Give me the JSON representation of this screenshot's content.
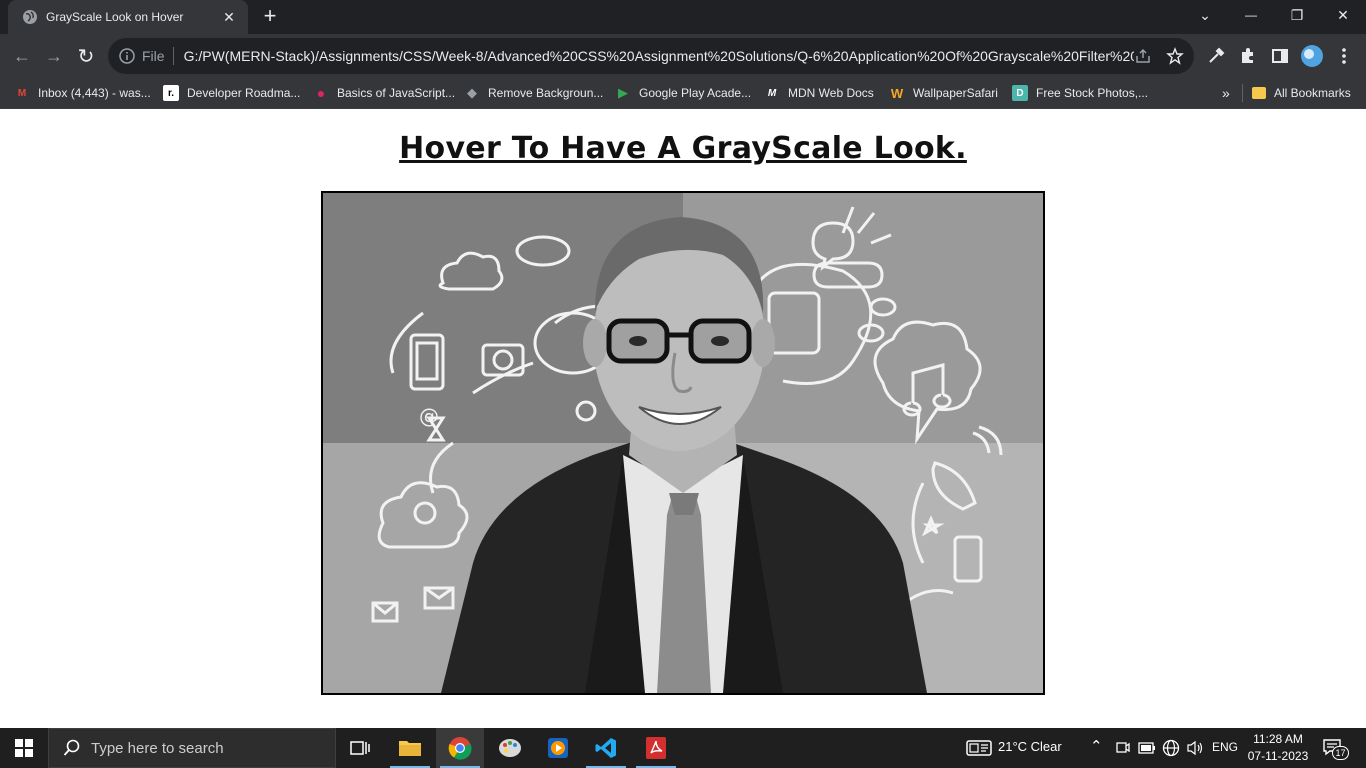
{
  "tab": {
    "title": "GrayScale Look on Hover",
    "close": "✕"
  },
  "new_tab": "+",
  "window_controls": {
    "dropdown": "⌄",
    "minimize": "—",
    "restore": "❐",
    "close": "✕"
  },
  "nav": {
    "back": "←",
    "forward": "→",
    "reload": "↻"
  },
  "omnibox": {
    "scheme_label": "File",
    "url": "G:/PW(MERN-Stack)/Assignments/CSS/Week-8/Advanced%20CSS%20Assignment%20Solutions/Q-6%20Application%20Of%20Grayscale%20Filter%20..."
  },
  "bookmarks": [
    {
      "label": "Inbox (4,443) - was...",
      "icon": "gmail-icon",
      "glyph": "M",
      "color": "#ea4335"
    },
    {
      "label": "Developer Roadma...",
      "icon": "roadmap-icon",
      "glyph": "r.",
      "color": "#ffffff"
    },
    {
      "label": "Basics of JavaScript...",
      "icon": "js-basics-icon",
      "glyph": "●",
      "color": "#e0245e"
    },
    {
      "label": "Remove Backgroun...",
      "icon": "remove-bg-icon",
      "glyph": "◆",
      "color": "#9aa0a6"
    },
    {
      "label": "Google Play Acade...",
      "icon": "google-play-icon",
      "glyph": "▶",
      "color": "#34a853"
    },
    {
      "label": "MDN Web Docs",
      "icon": "mdn-icon",
      "glyph": "M",
      "color": "#ffffff"
    },
    {
      "label": "WallpaperSafari",
      "icon": "wallpapersafari-icon",
      "glyph": "W",
      "color": "#f9a825"
    },
    {
      "label": "Free Stock Photos,...",
      "icon": "stock-photos-icon",
      "glyph": "D",
      "color": "#4db6ac"
    }
  ],
  "bookmarks_overflow": "»",
  "all_bookmarks": "All Bookmarks",
  "page": {
    "heading": "Hover To Have A GrayScale Look."
  },
  "taskbar": {
    "search_placeholder": "Type here to search",
    "weather": "21°C  Clear",
    "language": "ENG",
    "time": "11:28 AM",
    "date": "07-11-2023",
    "notifications": "17"
  }
}
